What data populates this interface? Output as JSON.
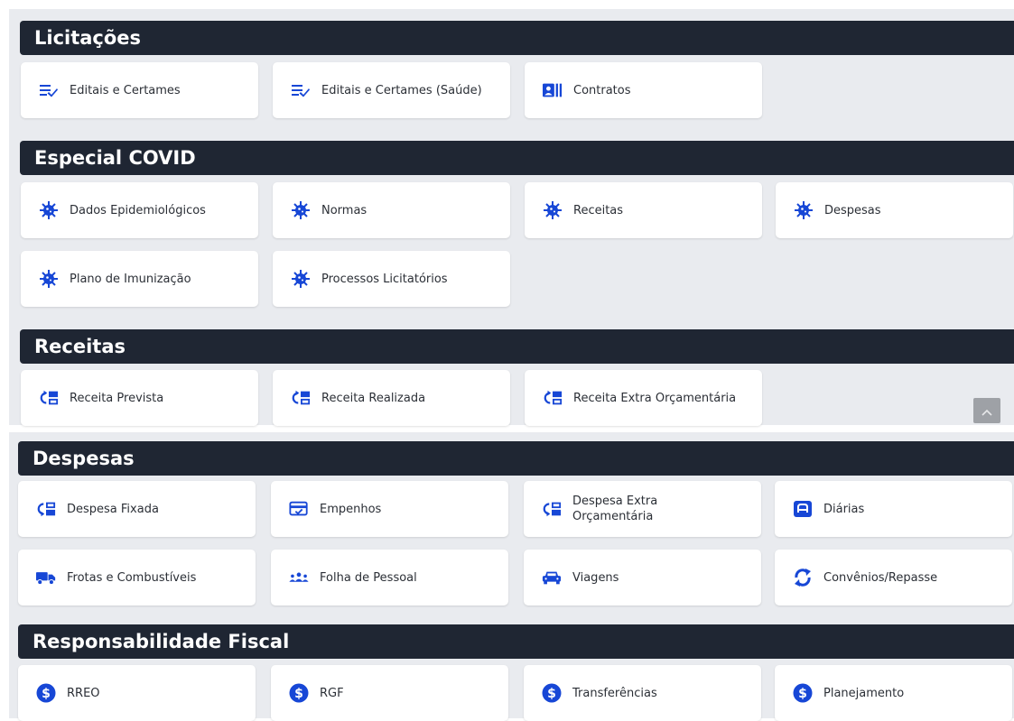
{
  "sections": {
    "licitacoes": {
      "title": "Licitações",
      "items": [
        "Editais e Certames",
        "Editais e Certames (Saúde)",
        "Contratos"
      ]
    },
    "covid": {
      "title": "Especial COVID",
      "items": [
        "Dados Epidemiológicos",
        "Normas",
        "Receitas",
        "Despesas",
        "Plano de Imunização",
        "Processos Licitatórios"
      ]
    },
    "receitas": {
      "title": "Receitas",
      "items": [
        "Receita Prevista",
        "Receita Realizada",
        "Receita Extra Orçamentária"
      ]
    },
    "despesas": {
      "title": "Despesas",
      "items": [
        "Despesa Fixada",
        "Empenhos",
        "Despesa Extra Orçamentária",
        "Diárias",
        "Frotas e Combustíveis",
        "Folha de Pessoal",
        "Viagens",
        "Convênios/Repasse"
      ]
    },
    "fiscal": {
      "title": "Responsabilidade Fiscal",
      "items": [
        "RREO",
        "RGF",
        "Transferências",
        "Planejamento"
      ]
    }
  },
  "icons": {
    "list-check": "list-check-icon",
    "contract": "contract-icon",
    "virus": "virus-icon",
    "revenue": "revenue-icon",
    "expense": "expense-icon",
    "commitment": "commitment-icon",
    "daily": "daily-allowance-icon",
    "truck": "truck-icon",
    "people": "people-icon",
    "car": "car-icon",
    "sync": "sync-icon",
    "dollar": "dollar-circle-icon",
    "chevron": "chevron-up-icon"
  },
  "colors": {
    "accent": "#1747d6",
    "header_bg": "#1f2633",
    "panel_bg": "#e9ebef"
  }
}
